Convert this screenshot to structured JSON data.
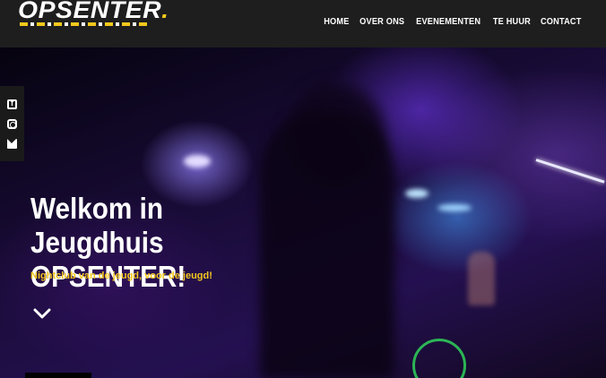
{
  "logo": {
    "text": "OPSENTER",
    "dot": "."
  },
  "nav": {
    "items": [
      "HOME",
      "OVER ONS",
      "EVENEMENTEN",
      "TE HUUR",
      "CONTACT"
    ]
  },
  "social": {
    "icons": [
      "facebook-icon",
      "instagram-icon",
      "envelope-icon"
    ]
  },
  "hero": {
    "title_line1": "Welkom in Jeugdhuis",
    "title_line2": "OPSENTER!",
    "subtitle": "Nightclub van de jeugd, voor de jeugd!"
  },
  "colors": {
    "accent": "#f4c81d",
    "header_bg": "#1e1e1e"
  }
}
